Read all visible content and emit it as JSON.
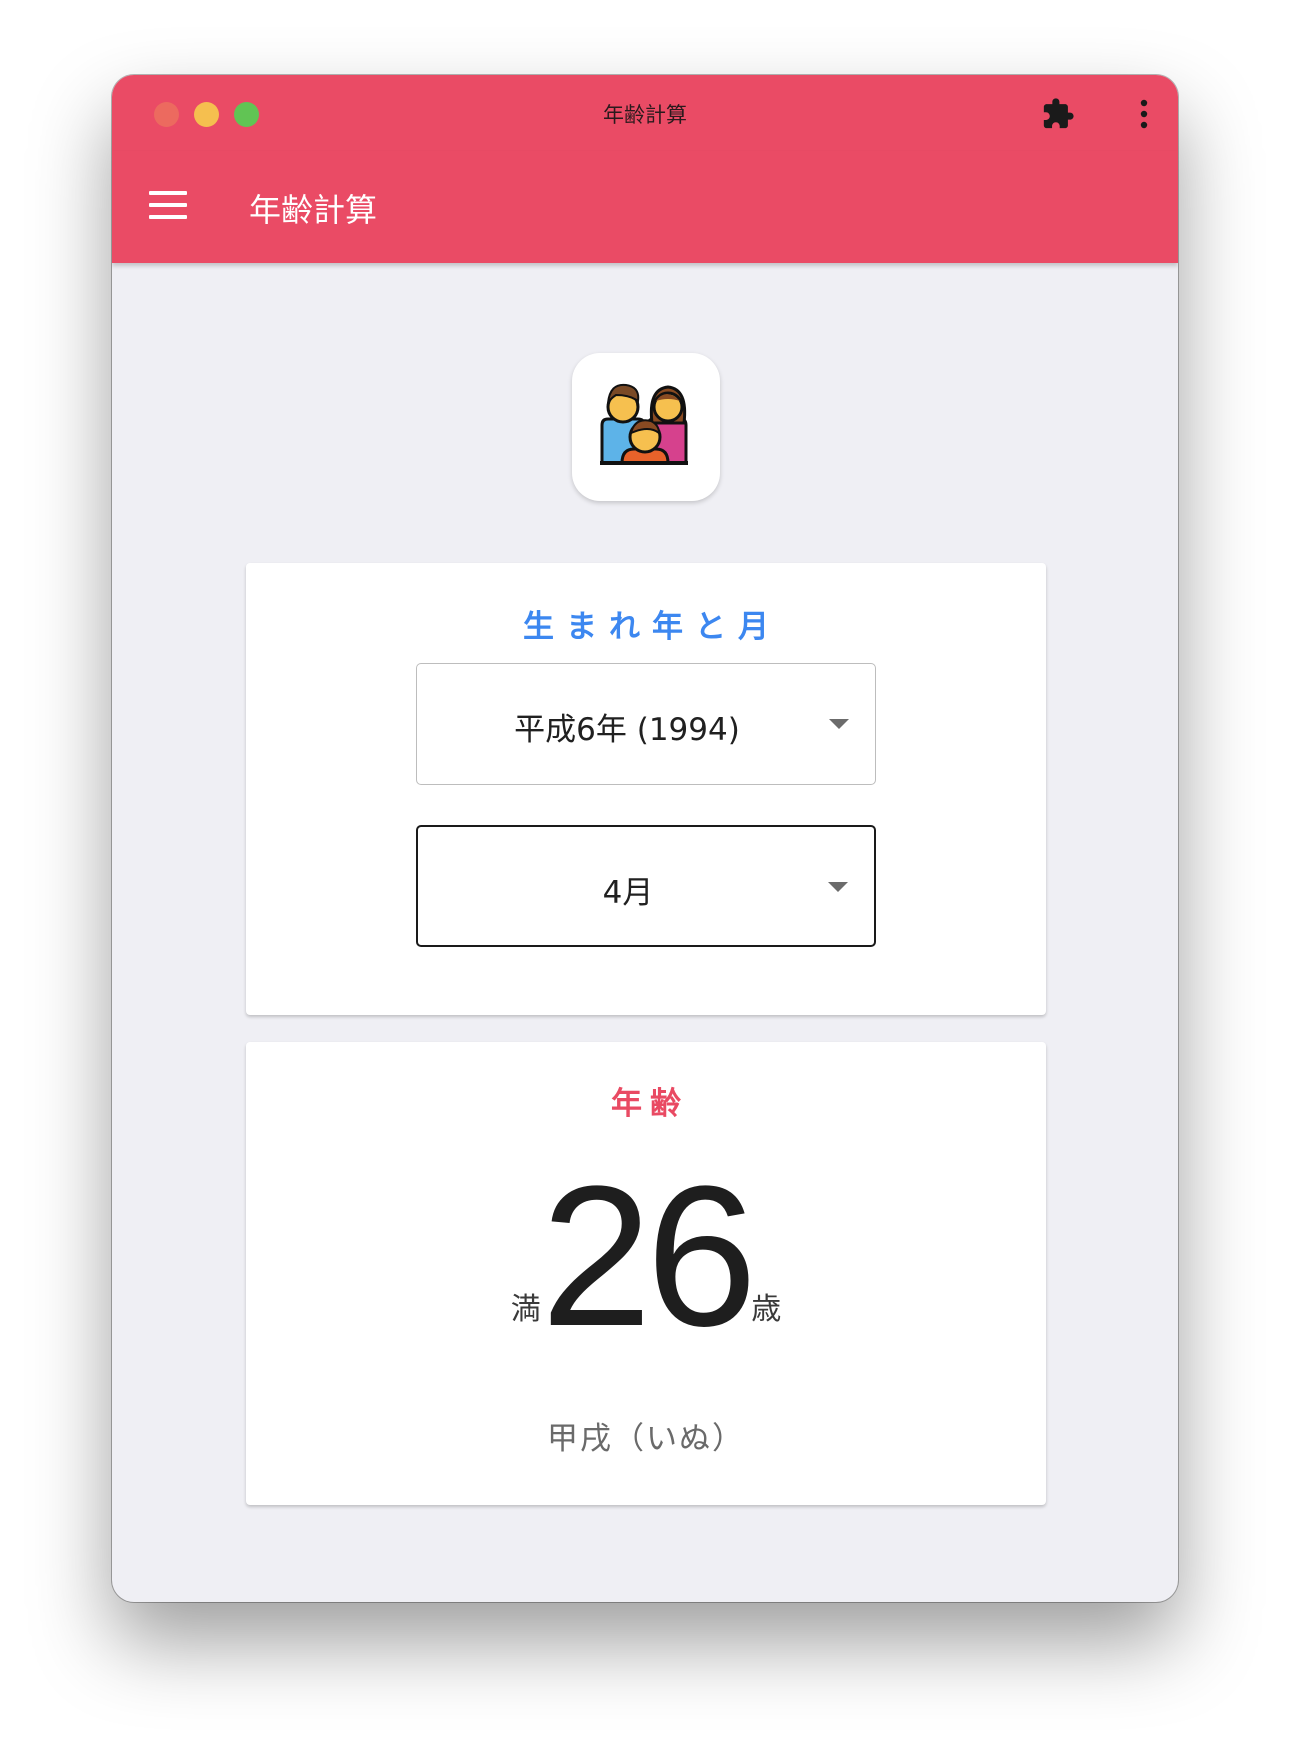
{
  "window": {
    "title": "年齢計算",
    "accent_color": "#ea4b65",
    "extension_icon": "puzzle-icon",
    "menu_icon": "more-vertical-icon"
  },
  "appbar": {
    "title": "年齢計算",
    "menu_icon": "hamburger-menu-icon"
  },
  "logo": {
    "icon": "family-icon"
  },
  "birth_card": {
    "title": "生まれ年と月",
    "title_color": "#3c87f0",
    "year_select": {
      "value": "平成6年 (1994)"
    },
    "month_select": {
      "value": "4月"
    }
  },
  "age_card": {
    "title": "年齢",
    "title_color": "#e94a63",
    "prefix": "満",
    "age": "26",
    "suffix": "歳",
    "zodiac": "甲戌（いぬ）"
  }
}
